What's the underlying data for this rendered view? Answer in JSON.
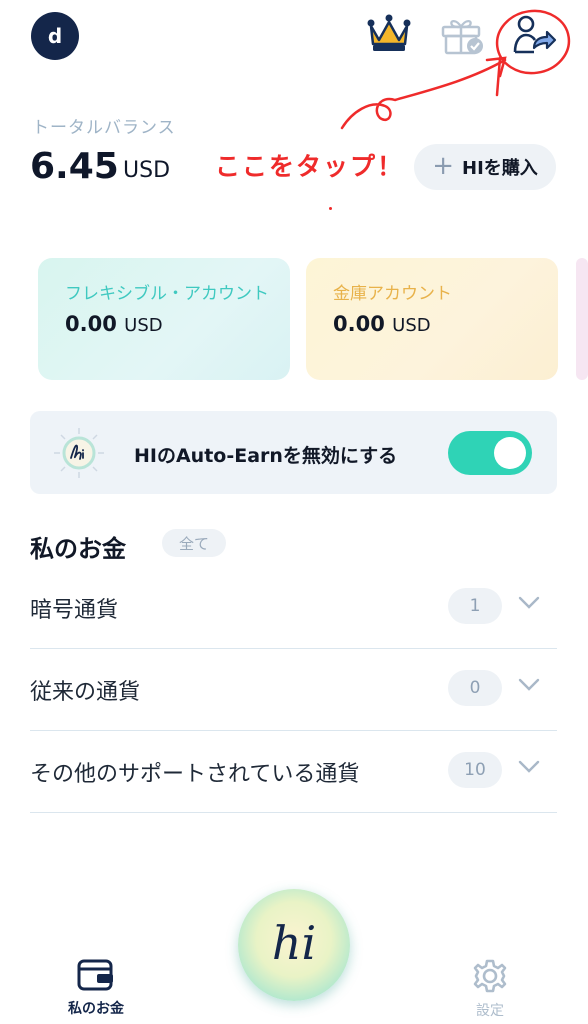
{
  "header": {
    "avatar_initial": "d",
    "icons": [
      "crown-icon",
      "gift-icon",
      "user-share-icon"
    ]
  },
  "balance": {
    "label": "トータルバランス",
    "value": "6.45",
    "unit": "USD",
    "buy_button": "HIを購入"
  },
  "annotation": {
    "text": "ここをタップ！",
    "color": "#ef2b2b"
  },
  "accounts": [
    {
      "title": "フレキシブル・アカウント",
      "amount": "0.00",
      "unit": "USD"
    },
    {
      "title": "金庫アカウント",
      "amount": "0.00",
      "unit": "USD"
    }
  ],
  "auto_earn": {
    "label": "HIのAuto-Earnを無効にする",
    "enabled": true
  },
  "my_money": {
    "title": "私のお金",
    "filter": "全て",
    "rows": [
      {
        "label": "暗号通貨",
        "count": "1"
      },
      {
        "label": "従来の通貨",
        "count": "0"
      },
      {
        "label": "その他のサポートされている通貨",
        "count": "10"
      }
    ]
  },
  "bottom_nav": {
    "wallet_label": "私のお金",
    "settings_label": "設定",
    "center_logo": "hi"
  },
  "colors": {
    "accent_teal": "#2fd3b6",
    "navy": "#14264a",
    "annotation_red": "#ef2b2b"
  }
}
